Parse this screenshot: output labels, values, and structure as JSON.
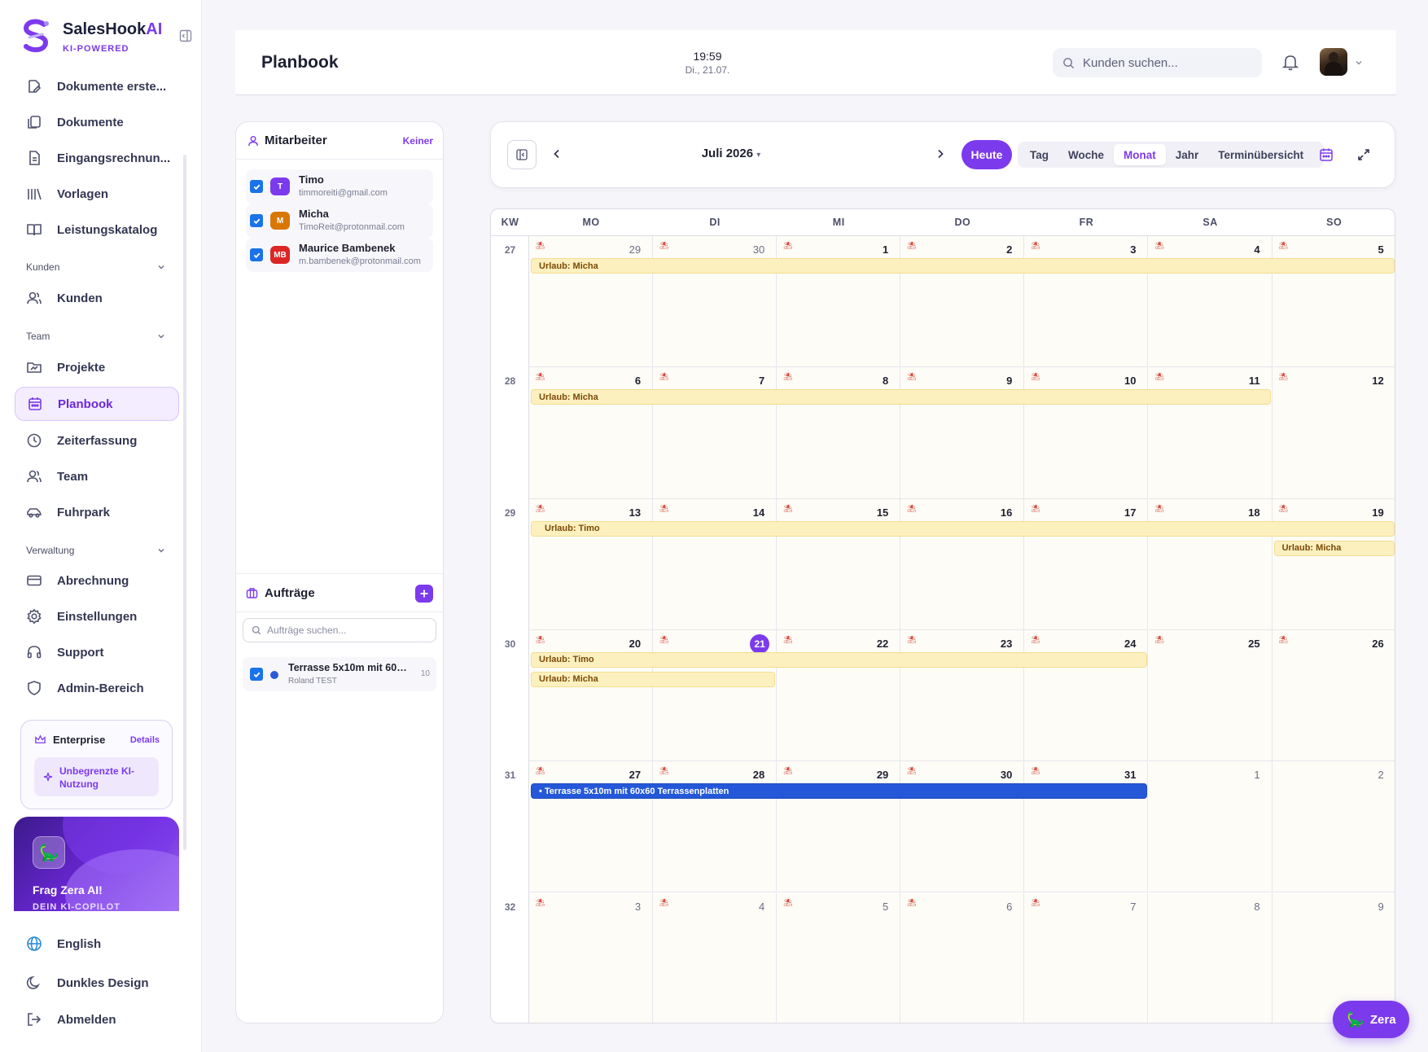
{
  "brand": {
    "name": "SalesHook",
    "name_suffix": "AI",
    "tagline": "KI-POWERED"
  },
  "sidebar": {
    "items": [
      {
        "label": "Dokumente erste...",
        "icon": "document-pen-icon"
      },
      {
        "label": "Dokumente",
        "icon": "documents-icon"
      },
      {
        "label": "Eingangsrechnun...",
        "icon": "invoice-icon"
      },
      {
        "label": "Vorlagen",
        "icon": "library-icon"
      },
      {
        "label": "Leistungskatalog",
        "icon": "book-icon"
      }
    ],
    "sections": {
      "kunden": {
        "label": "Kunden",
        "items": [
          {
            "label": "Kunden",
            "icon": "users-icon"
          }
        ]
      },
      "team": {
        "label": "Team",
        "items": [
          {
            "label": "Projekte",
            "icon": "folder-icon"
          },
          {
            "label": "Planbook",
            "icon": "calendar-icon",
            "active": true
          },
          {
            "label": "Zeiterfassung",
            "icon": "clock-icon"
          },
          {
            "label": "Team",
            "icon": "users-icon"
          },
          {
            "label": "Fuhrpark",
            "icon": "car-icon"
          }
        ]
      },
      "verwaltung": {
        "label": "Verwaltung",
        "items": [
          {
            "label": "Abrechnung",
            "icon": "credit-card-icon"
          },
          {
            "label": "Einstellungen",
            "icon": "gear-icon"
          },
          {
            "label": "Support",
            "icon": "headset-icon"
          },
          {
            "label": "Admin-Bereich",
            "icon": "shield-icon"
          }
        ]
      }
    },
    "plan": {
      "name": "Enterprise",
      "details": "Details",
      "feature": "Unbegrenzte KI-Nutzung"
    },
    "zera_card": {
      "title": "Frag Zera AI!",
      "subtitle": "DEIN KI-COPILOT"
    },
    "bottom": {
      "language": "English",
      "theme": "Dunkles Design",
      "logout": "Abmelden"
    }
  },
  "header": {
    "title": "Planbook",
    "time": "19:59",
    "date": "Di., 21.07.",
    "search_placeholder": "Kunden suchen..."
  },
  "employees": {
    "title": "Mitarbeiter",
    "clear_label": "Keiner",
    "list": [
      {
        "initials": "T",
        "name": "Timo",
        "email": "timmoreiti@gmail.com",
        "color": "#7c3aed",
        "checked": true
      },
      {
        "initials": "M",
        "name": "Micha",
        "email": "TimoReit@protonmail.com",
        "color": "#d97706",
        "checked": true
      },
      {
        "initials": "MB",
        "name": "Maurice Bambenek",
        "email": "m.bambenek@protonmail.com",
        "color": "#dc2626",
        "checked": true
      }
    ]
  },
  "orders": {
    "title": "Aufträge",
    "search_placeholder": "Aufträge suchen...",
    "list": [
      {
        "name": "Terrasse 5x10m mit 60x...",
        "client": "Roland TEST",
        "count": "10",
        "color": "#2a5bd7",
        "checked": true
      }
    ]
  },
  "toolbar": {
    "month_label": "Juli 2026",
    "today_label": "Heute",
    "views": [
      "Tag",
      "Woche",
      "Monat",
      "Jahr",
      "Terminübersicht"
    ],
    "active_view": "Monat"
  },
  "calendar": {
    "kw_label": "KW",
    "weekdays": [
      "MO",
      "DI",
      "MI",
      "DO",
      "FR",
      "SA",
      "SO"
    ],
    "weeks": [
      {
        "kw": "27",
        "days": [
          "29",
          "30",
          "1",
          "2",
          "3",
          "4",
          "5"
        ],
        "other": [
          true,
          true,
          false,
          false,
          false,
          false,
          false
        ]
      },
      {
        "kw": "28",
        "days": [
          "6",
          "7",
          "8",
          "9",
          "10",
          "11",
          "12"
        ],
        "other": [
          false,
          false,
          false,
          false,
          false,
          false,
          false
        ]
      },
      {
        "kw": "29",
        "days": [
          "13",
          "14",
          "15",
          "16",
          "17",
          "18",
          "19"
        ],
        "other": [
          false,
          false,
          false,
          false,
          false,
          false,
          false
        ]
      },
      {
        "kw": "30",
        "days": [
          "20",
          "21",
          "22",
          "23",
          "24",
          "25",
          "26"
        ],
        "other": [
          false,
          false,
          false,
          false,
          false,
          false,
          false
        ]
      },
      {
        "kw": "31",
        "days": [
          "27",
          "28",
          "29",
          "30",
          "31",
          "1",
          "2"
        ],
        "other": [
          false,
          false,
          false,
          false,
          false,
          true,
          true
        ]
      },
      {
        "kw": "32",
        "days": [
          "3",
          "4",
          "5",
          "6",
          "7",
          "8",
          "9"
        ],
        "other": [
          true,
          true,
          true,
          true,
          true,
          true,
          true
        ]
      }
    ],
    "today": {
      "week": 3,
      "day": 1
    },
    "events": [
      {
        "label": "Urlaub: Micha",
        "type": "vacation",
        "week": 0,
        "start": 0,
        "end": 6,
        "lane": 0
      },
      {
        "label": "Urlaub: Micha",
        "type": "vacation",
        "week": 1,
        "start": 0,
        "end": 5,
        "lane": 0
      },
      {
        "label": "Urlaub: Timo",
        "type": "vacation",
        "week": 2,
        "start": 0,
        "end": 6,
        "lane": 0
      },
      {
        "label": "Urlaub: Micha",
        "type": "vacation",
        "week": 2,
        "start": 6,
        "end": 6,
        "lane": 1
      },
      {
        "label": "Urlaub: Timo",
        "type": "vacation",
        "week": 3,
        "start": 0,
        "end": 4,
        "lane": 0
      },
      {
        "label": "Urlaub: Micha",
        "type": "vacation",
        "week": 3,
        "start": 0,
        "end": 1,
        "lane": 1
      },
      {
        "label": "• Terrasse 5x10m mit 60x60 Terrassenplatten",
        "type": "job",
        "week": 4,
        "start": 0,
        "end": 4,
        "lane": 0
      }
    ]
  },
  "fab": {
    "label": "Zera"
  }
}
